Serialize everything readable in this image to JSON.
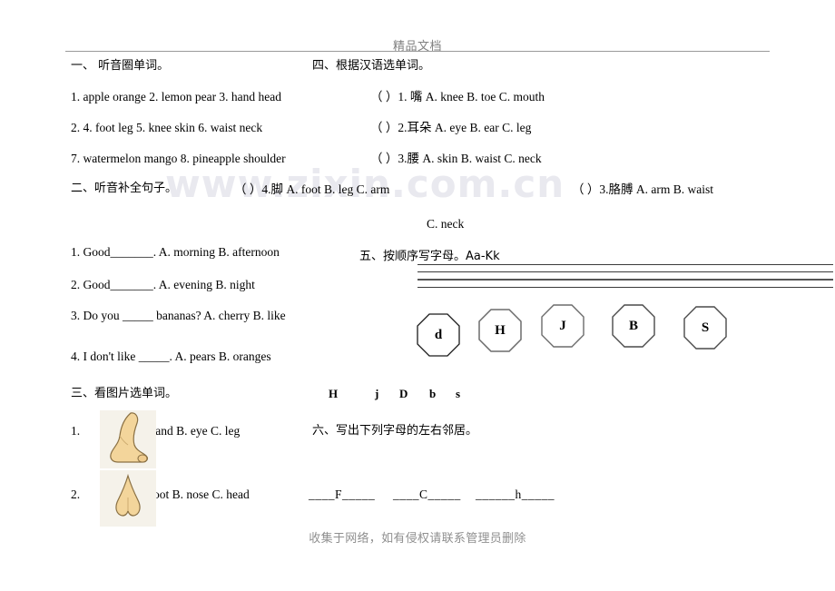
{
  "page": {
    "header": "精品文档",
    "footer": "收集于网络，如有侵权请联系管理员删除",
    "watermark": "www.zixin.com.cn"
  },
  "section1": {
    "heading": "一、 听音圈单词。",
    "line1": "1.  apple  orange  2. lemon  pear  3. hand  head",
    "line2": "2.  4. foot  leg     5. knee  skin    6. waist   neck",
    "line3": "7. watermelon   mango 8. pineapple   shoulder"
  },
  "section2": {
    "heading": "二、听音补全句子。",
    "items": [
      "1. Good_______.  A. morning   B. afternoon",
      "2. Good_______.  A. evening   B. night",
      "3. Do you _____ bananas? A. cherry  B. like",
      "4. I don't like _____.  A. pears  B. oranges"
    ]
  },
  "section3": {
    "heading": "三、看图片选单词。",
    "items": [
      {
        "num": "1.",
        "image": "foot-photo",
        "text": "A. hand  B. eye  C. leg"
      },
      {
        "num": "2.",
        "image": "nose-photo",
        "text": "A. foot  B. nose  C. head"
      }
    ]
  },
  "section4": {
    "heading": "四、根据汉语选单词。",
    "items": [
      "（    ）1. 嘴   A. knee   B. toe    C. mouth",
      "（    ）2.耳朵  A. eye   B. ear   C. leg",
      "（    ）3.腰   A. skin   B. waist  C. neck",
      "（  ）4.脚 A. foot   B. leg  C. arm",
      "（    ）3.胳膊 A. arm   B. waist",
      "C. neck"
    ]
  },
  "section5": {
    "heading": "五、按顺序写字母。Aa-Kk",
    "octagons": [
      "d",
      "H",
      "J",
      "B",
      "S"
    ],
    "letters_row": [
      "H",
      "j",
      "D",
      "b",
      "s"
    ]
  },
  "section6": {
    "heading": "六、写出下列字母的左右邻居。",
    "blanks": [
      "____F_____",
      "____C_____",
      "______h_____"
    ]
  }
}
